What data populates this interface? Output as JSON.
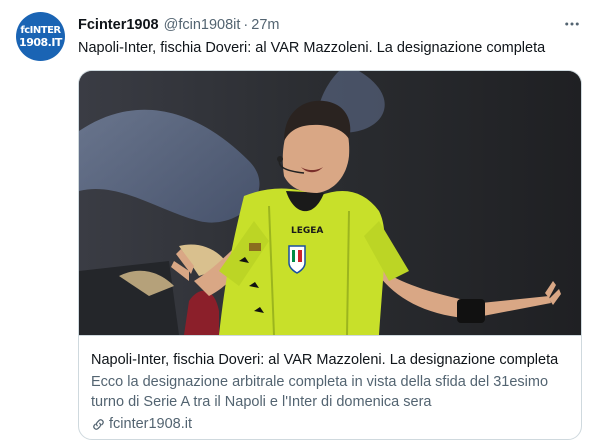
{
  "author": {
    "display_name": "Fcinter1908",
    "handle": "@fcin1908it",
    "separator": "·",
    "time": "27m",
    "avatar_icon": "fcinter1908-logo",
    "avatar_text_line1": "fcINTER",
    "avatar_text_line2": "1908.IT",
    "avatar_color": "#1a64b4"
  },
  "menu": {
    "more_icon": "more-horizontal-icon",
    "more_glyph": "•••"
  },
  "tweet": {
    "text": "Napoli-Inter, fischia Doveri: al VAR Mazzoleni. La designazione completa"
  },
  "card": {
    "image_icon": "referee-photo",
    "shirt_brand": "LEGEA",
    "title": "Napoli-Inter, fischia Doveri: al VAR Mazzoleni. La designazione completa",
    "description": "Ecco la designazione arbitrale completa in vista della sfida del 31esimo turno di Serie A tra il Napoli e l'Inter di domenica sera",
    "domain": "fcinter1908.it",
    "domain_icon": "link-icon"
  },
  "colors": {
    "text_primary": "#0f1419",
    "text_secondary": "#536471",
    "border": "#cfd9de",
    "referee_shirt": "#c8e02a"
  }
}
